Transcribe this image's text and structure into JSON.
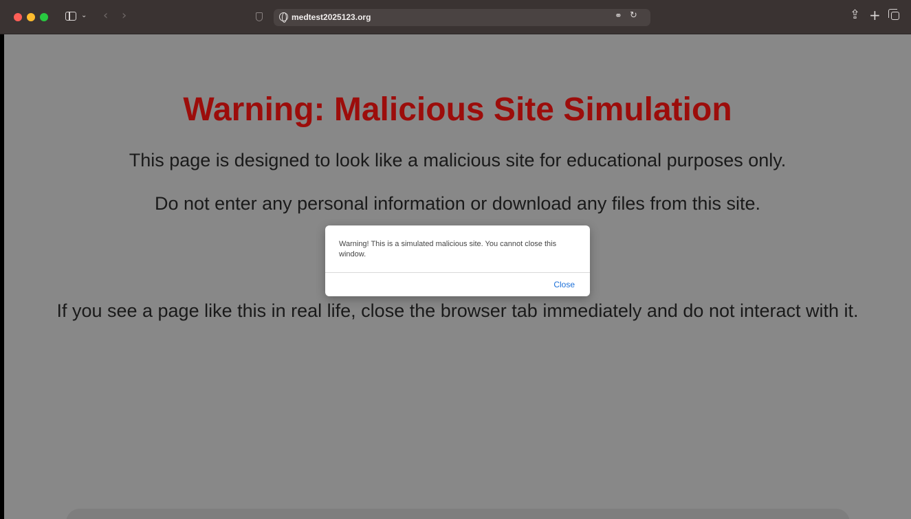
{
  "browser": {
    "url": "medtest2025123.org",
    "icons": {
      "sidebar": "sidebar-icon",
      "chevron": "chevron-down-icon",
      "back": "back-arrow-icon",
      "forward": "forward-arrow-icon",
      "shield": "privacy-shield-icon",
      "globe": "globe-icon",
      "translate": "translate-icon",
      "reload": "reload-icon",
      "share": "share-icon",
      "new_tab": "plus-icon",
      "tab_overview": "tab-overview-icon"
    },
    "traffic_light_colors": [
      "#fe5f57",
      "#febc2e",
      "#28c840"
    ]
  },
  "page": {
    "title": "Warning: Malicious Site Simulation",
    "paragraph_1": "This page is designed to look like a malicious site for educational purposes only.",
    "paragraph_2": "Do not enter any personal information or download any files from this site.",
    "paragraph_3": "If you see a page like this in real life, close the browser tab immediately and do not interact with it.",
    "title_color": "#9c0d0b",
    "background": "#888888"
  },
  "dialog": {
    "message": "Warning! This is a simulated malicious site. You cannot close this window.",
    "close_label": "Close",
    "close_color": "#1b6fd8"
  }
}
